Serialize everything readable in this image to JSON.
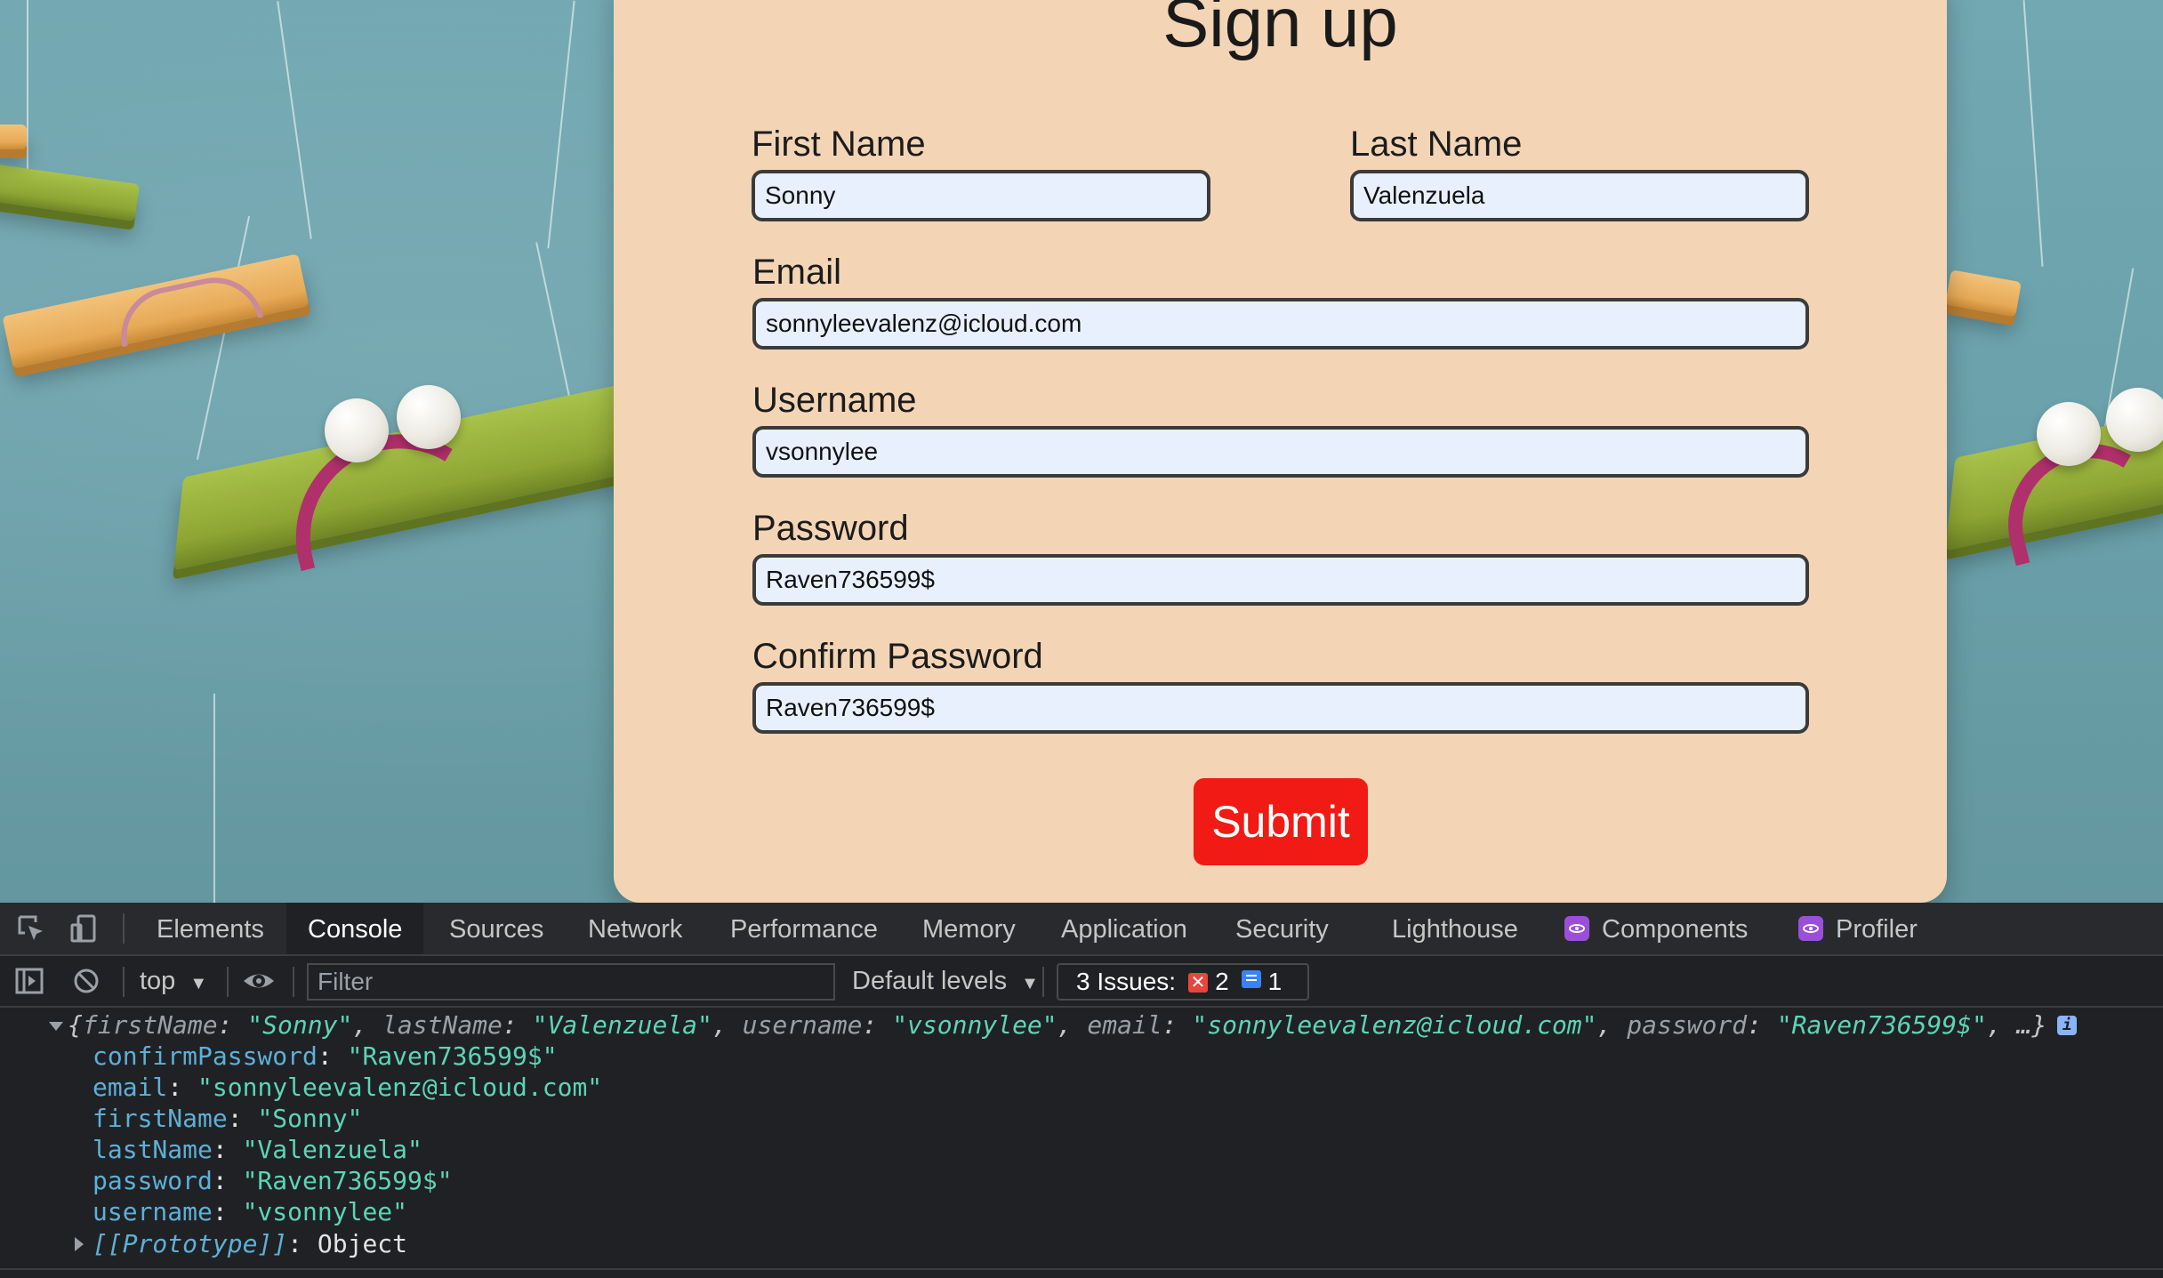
{
  "form": {
    "title": "Sign up",
    "first_name": {
      "label": "First Name",
      "value": "Sonny"
    },
    "last_name": {
      "label": "Last Name",
      "value": "Valenzuela"
    },
    "email": {
      "label": "Email",
      "value": "sonnyleevalenz@icloud.com"
    },
    "username": {
      "label": "Username",
      "value": "vsonnylee"
    },
    "password": {
      "label": "Password",
      "value": "Raven736599$"
    },
    "confirm_password": {
      "label": "Confirm Password",
      "value": "Raven736599$"
    },
    "submit_label": "Submit",
    "submit_color": "#f11a14",
    "card_color": "#f3d5b5"
  },
  "devtools": {
    "tabs": [
      "Elements",
      "Console",
      "Sources",
      "Network",
      "Performance",
      "Memory",
      "Application",
      "Security",
      "Lighthouse"
    ],
    "active_tab": "Console",
    "extension_tabs": [
      "Components",
      "Profiler"
    ],
    "toolbar": {
      "context": "top",
      "filter_placeholder": "Filter",
      "levels": "Default levels",
      "issues_label": "3 Issues:",
      "issues_errors": "2",
      "issues_info": "1"
    },
    "console": {
      "summary": {
        "open": "{",
        "k1": "firstName",
        "v1": "\"Sonny\"",
        "k2": "lastName",
        "v2": "\"Valenzuela\"",
        "k3": "username",
        "v3": "\"vsonnylee\"",
        "k4": "email",
        "v4": "\"sonnyleevalenz@icloud.com\"",
        "k5": "password",
        "v5": "\"Raven736599$\"",
        "tail": ", …}"
      },
      "properties": [
        {
          "key": "confirmPassword",
          "value": "\"Raven736599$\""
        },
        {
          "key": "email",
          "value": "\"sonnyleevalenz@icloud.com\""
        },
        {
          "key": "firstName",
          "value": "\"Sonny\""
        },
        {
          "key": "lastName",
          "value": "\"Valenzuela\""
        },
        {
          "key": "password",
          "value": "\"Raven736599$\""
        },
        {
          "key": "username",
          "value": "\"vsonnylee\""
        }
      ],
      "prototype_key": "[[Prototype]]",
      "prototype_value": "Object"
    }
  }
}
